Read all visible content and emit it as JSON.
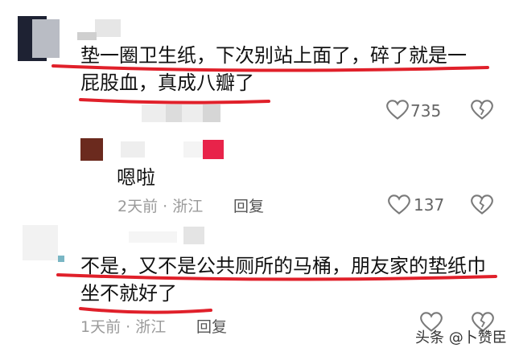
{
  "comments": [
    {
      "text_line1": "垫一圈卫生纸，下次别站上面了，碎了就是一",
      "text_line2": "屁股血，真成八瓣了",
      "likes": "735"
    },
    {
      "text": "嗯啦",
      "time_location": "2天前 · 浙江",
      "reply_label": "回复",
      "likes": "137"
    },
    {
      "text_line1": "不是，又不是公共厕所的马桶，朋友家的垫纸巾",
      "text_line2": "坐不就好了",
      "time_location": "1天前 · 浙江",
      "reply_label": "回复"
    }
  ],
  "watermark": "头条 @卜赞臣",
  "colors": {
    "underline_red": "#e0202a",
    "icon_gray": "#7a7a7a"
  }
}
